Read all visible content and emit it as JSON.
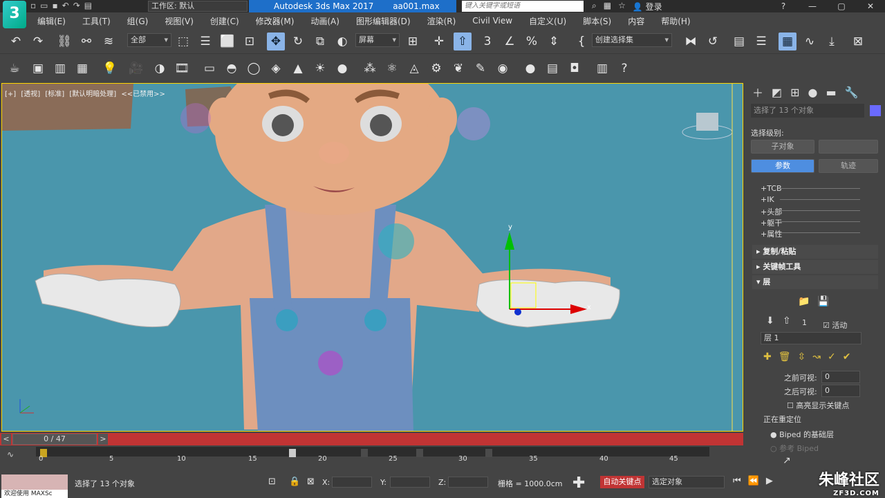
{
  "app": {
    "logo_text": "3",
    "workspace_label": "工作区: 默认",
    "title": "Autodesk 3ds Max 2017",
    "filename": "aa001.max",
    "search_placeholder": "键入关键字或短语",
    "login_label": "登录"
  },
  "menu": [
    "编辑(E)",
    "工具(T)",
    "组(G)",
    "视图(V)",
    "创建(C)",
    "修改器(M)",
    "动画(A)",
    "图形编辑器(D)",
    "渲染(R)",
    "Civil View",
    "自定义(U)",
    "脚本(S)",
    "内容",
    "帮助(H)"
  ],
  "toolbar": {
    "filter_dropdown": "全部",
    "coord_dropdown": "屏幕",
    "selection_set": "创建选择集",
    "snap_label": "3"
  },
  "viewport": {
    "label_parts": [
      "[+]",
      "[透视]",
      "[标准]",
      "[默认明暗处理]",
      "<<已禁用>>"
    ],
    "axis_y": "y",
    "axis_x": "x"
  },
  "command_panel": {
    "selection_info": "选择了 13 个对象",
    "selection_level_label": "选择级别:",
    "sub_object_button": "子对象",
    "params_button": "参数",
    "track_button": "轨迹",
    "tree_items": [
      "+TCB",
      "+IK",
      "+头部",
      "+躯干",
      "+属性"
    ],
    "rollouts": [
      "复制/粘贴",
      "关键帧工具",
      "层"
    ],
    "layer_count": "1",
    "active_label": "活动",
    "layer_name": "层 1",
    "before_visible_label": "之前可视:",
    "before_visible_value": "0",
    "after_visible_label": "之后可视:",
    "after_visible_value": "0",
    "highlight_keys_label": "高亮显示关键点",
    "retarget_group": "正在重定位",
    "biped_base_layer": "Biped 的基础层",
    "ref_biped": "参考 Biped"
  },
  "timeline": {
    "frame_display": "0 / 47",
    "ticks": [
      "0",
      "5",
      "10",
      "15",
      "20",
      "25",
      "30",
      "35",
      "40",
      "45"
    ]
  },
  "statusbar": {
    "welcome": "欢迎使用 MAXSc",
    "status_text": "选择了 13 个对象",
    "x_label": "X:",
    "y_label": "Y:",
    "z_label": "Z:",
    "grid_label": "栅格 = 1000.0cm",
    "autokey_label": "自动关键点",
    "selection_filter": "选定对象"
  },
  "watermark": {
    "main": "朱峰社区",
    "sub": "ZF3D.COM"
  },
  "colors": {
    "viewport_bg": "#4a96ac",
    "accent_blue": "#4e8ee0",
    "timeline_red": "#c13434"
  }
}
